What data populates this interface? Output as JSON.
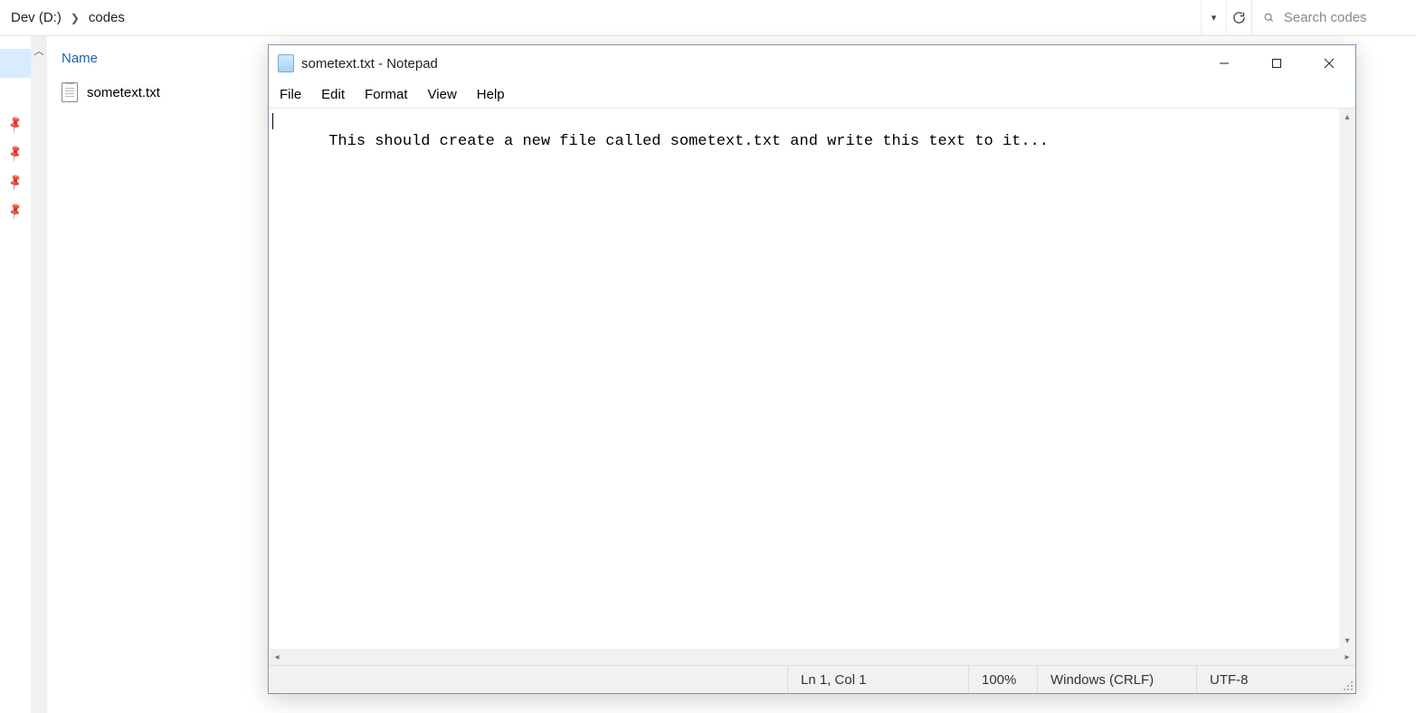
{
  "explorer": {
    "breadcrumb": {
      "root": "Dev (D:)",
      "child": "codes"
    },
    "search_placeholder": "Search codes",
    "column_header": "Name",
    "files": [
      {
        "name": "sometext.txt"
      }
    ]
  },
  "notepad": {
    "title": "sometext.txt - Notepad",
    "menu": {
      "file": "File",
      "edit": "Edit",
      "format": "Format",
      "view": "View",
      "help": "Help"
    },
    "content": "This should create a new file called sometext.txt and write this text to it...",
    "status": {
      "position": "Ln 1, Col 1",
      "zoom": "100%",
      "line_ending": "Windows (CRLF)",
      "encoding": "UTF-8"
    }
  }
}
